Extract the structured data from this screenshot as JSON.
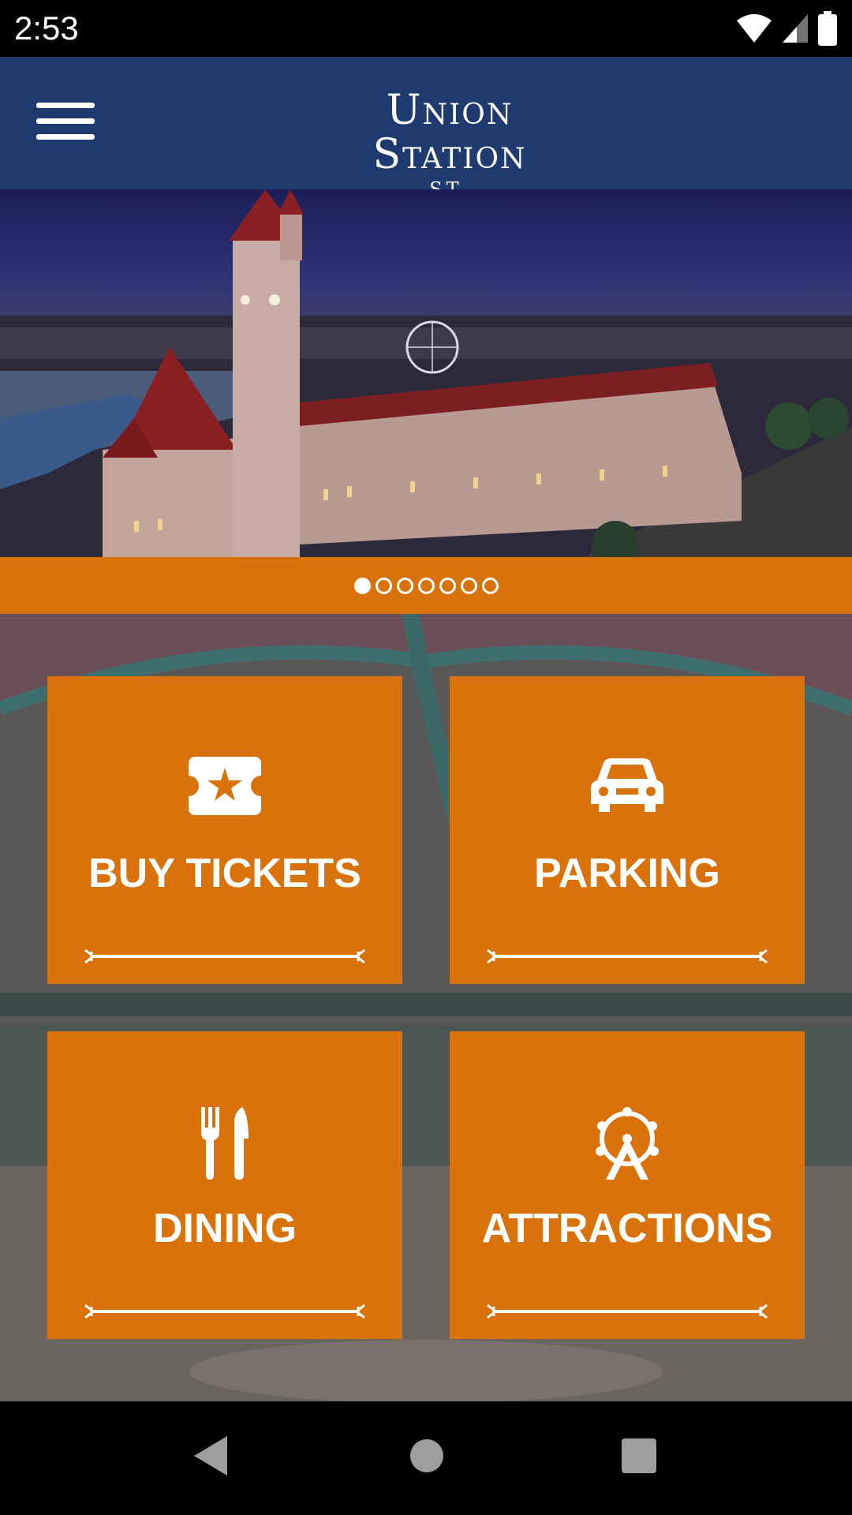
{
  "status_bar": {
    "time": "2:53",
    "icons": [
      "wifi-icon",
      "cell-signal-icon",
      "battery-icon"
    ]
  },
  "header": {
    "logo_main": "Union Station",
    "logo_sub": "ST. LOUIS",
    "background_color": "#1f3a6e"
  },
  "hero": {
    "carousel_total": 7,
    "carousel_active_index": 0
  },
  "tiles": [
    {
      "label": "BUY TICKETS",
      "icon": "ticket-icon"
    },
    {
      "label": "PARKING",
      "icon": "car-icon"
    },
    {
      "label": "DINING",
      "icon": "fork-knife-icon"
    },
    {
      "label": "ATTRACTIONS",
      "icon": "ferris-wheel-icon"
    }
  ],
  "colors": {
    "accent_orange": "#d9720b",
    "header_blue": "#1f3a6e"
  },
  "nav_bar": {
    "buttons": [
      "back-icon",
      "home-icon",
      "recents-icon"
    ]
  }
}
